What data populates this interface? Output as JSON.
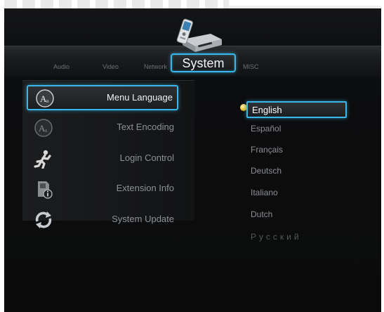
{
  "tabs": {
    "audio": "Audio",
    "video": "Video",
    "network": "Network",
    "system": "System",
    "misc": "MISC"
  },
  "menu": [
    {
      "label": "Menu Language",
      "icon": "language-icon",
      "selected": true
    },
    {
      "label": "Text Encoding",
      "icon": "text-encoding-icon",
      "selected": false
    },
    {
      "label": "Login Control",
      "icon": "running-person-icon",
      "selected": false
    },
    {
      "label": "Extension Info",
      "icon": "sd-card-info-icon",
      "selected": false
    },
    {
      "label": "System Update",
      "icon": "refresh-arrows-icon",
      "selected": false
    }
  ],
  "languages": {
    "selected": "English",
    "items": [
      "Español",
      "Français",
      "Deutsch",
      "Italiano",
      "Dutch",
      "Русский"
    ]
  },
  "colors": {
    "accent": "#3ab7ea",
    "background": "#0c0d0e",
    "selected_bullet": "#e7b720"
  }
}
